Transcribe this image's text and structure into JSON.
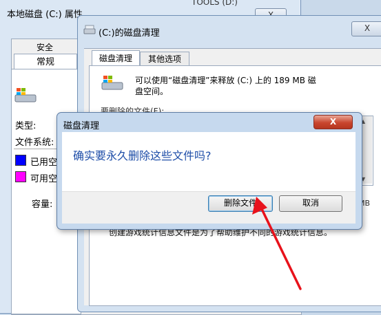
{
  "props_window": {
    "title": "本地磁盘 (C:) 属性",
    "close_label": "X",
    "tabs": [
      "安全",
      "常规"
    ],
    "type_label": "类型:",
    "fs_label": "文件系统:",
    "used_label": "已用空",
    "free_label": "可用空",
    "capacity_label": "容量:",
    "used_color": "#0000ff",
    "free_color": "#ff00ff",
    "icon": "drive-icon"
  },
  "tools_window": {
    "title": "TOOLS (D:)"
  },
  "cleanup_window": {
    "title": "(C:)的磁盘清理",
    "close_label": "X",
    "tabs": [
      "磁盘清理",
      "其他选项"
    ],
    "description_line1": "可以使用“磁盘清理”来释放  (C:) 上的 189 MB 磁",
    "description_line2": "盘空间。",
    "files_label": "要删除的文件(F):",
    "size_fragment": "MB",
    "bottom_description": "创建游戏统计信息文件是为了帮助维护不同的游戏统计信息。",
    "icon": "disk-cleanup-icon"
  },
  "confirm_dialog": {
    "title": "磁盘清理",
    "close_label": "X",
    "message": "确实要永久删除这些文件吗?",
    "delete_label": "删除文件",
    "cancel_label": "取消"
  },
  "annotation": {
    "arrow_color": "#e8121b"
  }
}
